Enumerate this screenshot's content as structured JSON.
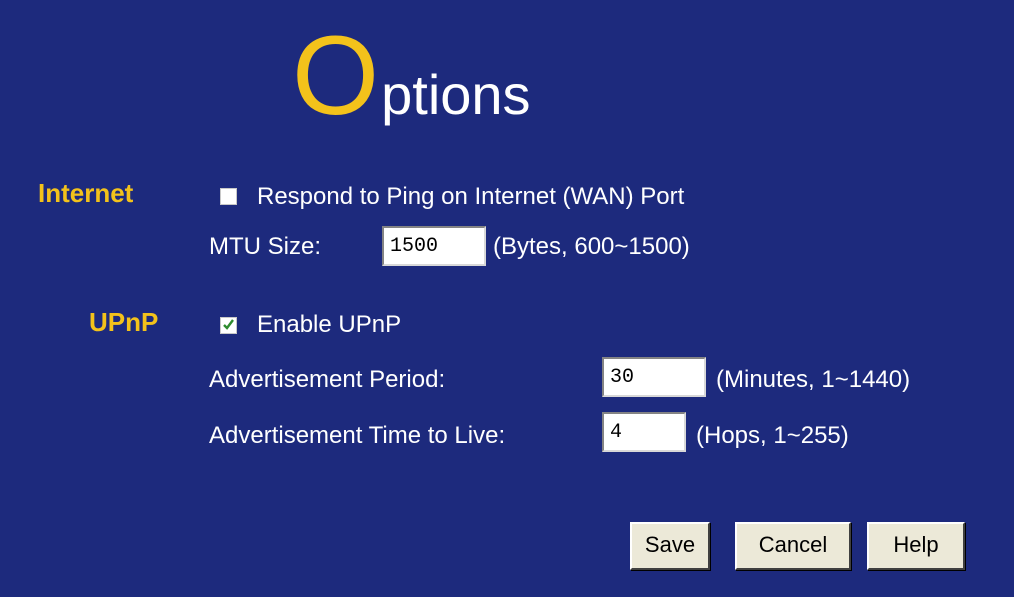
{
  "title": {
    "first_letter": "O",
    "rest": "ptions"
  },
  "internet": {
    "section_label": "Internet",
    "ping_label": "Respond to Ping on Internet (WAN) Port",
    "ping_checked": false,
    "mtu_label": "MTU Size:",
    "mtu_value": "1500",
    "mtu_hint": "(Bytes, 600~1500)"
  },
  "upnp": {
    "section_label": "UPnP",
    "enable_label": "Enable UPnP",
    "enable_checked": true,
    "period_label": "Advertisement Period:",
    "period_value": "30",
    "period_hint": "(Minutes, 1~1440)",
    "ttl_label": "Advertisement Time to Live:",
    "ttl_value": "4",
    "ttl_hint": "(Hops, 1~255)"
  },
  "buttons": {
    "save": "Save",
    "cancel": "Cancel",
    "help": "Help"
  },
  "colors": {
    "background": "#1d2a7d",
    "accent": "#f3c21b",
    "text": "#ffffff",
    "check": "#2e8b2e"
  }
}
